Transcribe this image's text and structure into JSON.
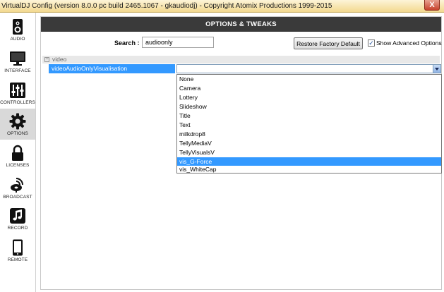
{
  "window": {
    "title": "VirtualDJ Config (version 8.0.0 pc build 2465.1067 - gkaudiodj) - Copyright Atomix Productions 1999-2015",
    "close_glyph": "X"
  },
  "sidebar": {
    "items": [
      {
        "label": "AUDIO",
        "icon": "speaker-icon",
        "active": false
      },
      {
        "label": "INTERFACE",
        "icon": "monitor-icon",
        "active": false
      },
      {
        "label": "CONTROLLERS",
        "icon": "sliders-icon",
        "active": false
      },
      {
        "label": "OPTIONS",
        "icon": "gear-icon",
        "active": true
      },
      {
        "label": "LICENSES",
        "icon": "lock-icon",
        "active": false
      },
      {
        "label": "BROADCAST",
        "icon": "broadcast-icon",
        "active": false
      },
      {
        "label": "RECORD",
        "icon": "music-note-icon",
        "active": false
      },
      {
        "label": "REMOTE",
        "icon": "tablet-icon",
        "active": false
      }
    ]
  },
  "panel": {
    "title": "OPTIONS & TWEAKS",
    "search_label": "Search :",
    "search_value": "audioonly",
    "restore_label": "Restore Factory Default",
    "show_advanced_label": "Show Advanced Options",
    "show_advanced_checked": true,
    "check_glyph": "✓"
  },
  "tree": {
    "group_toggle": "−",
    "group_name": "video",
    "setting_name": "videoAudioOnlyVisualisation",
    "setting_value": ""
  },
  "dropdown": {
    "options": [
      "None",
      "Camera",
      "Lottery",
      "Slideshow",
      "Title",
      "Text",
      "milkdrop8",
      "TellyMediaV",
      "TellyVisualsV",
      "vis_G-Force",
      "vis_WhiteCap"
    ],
    "selected_index": 9
  },
  "colors": {
    "header_bg": "#3a3a3a",
    "selection": "#3399ff",
    "titlebar": "#f3d98f",
    "close_button": "#c7432d"
  }
}
